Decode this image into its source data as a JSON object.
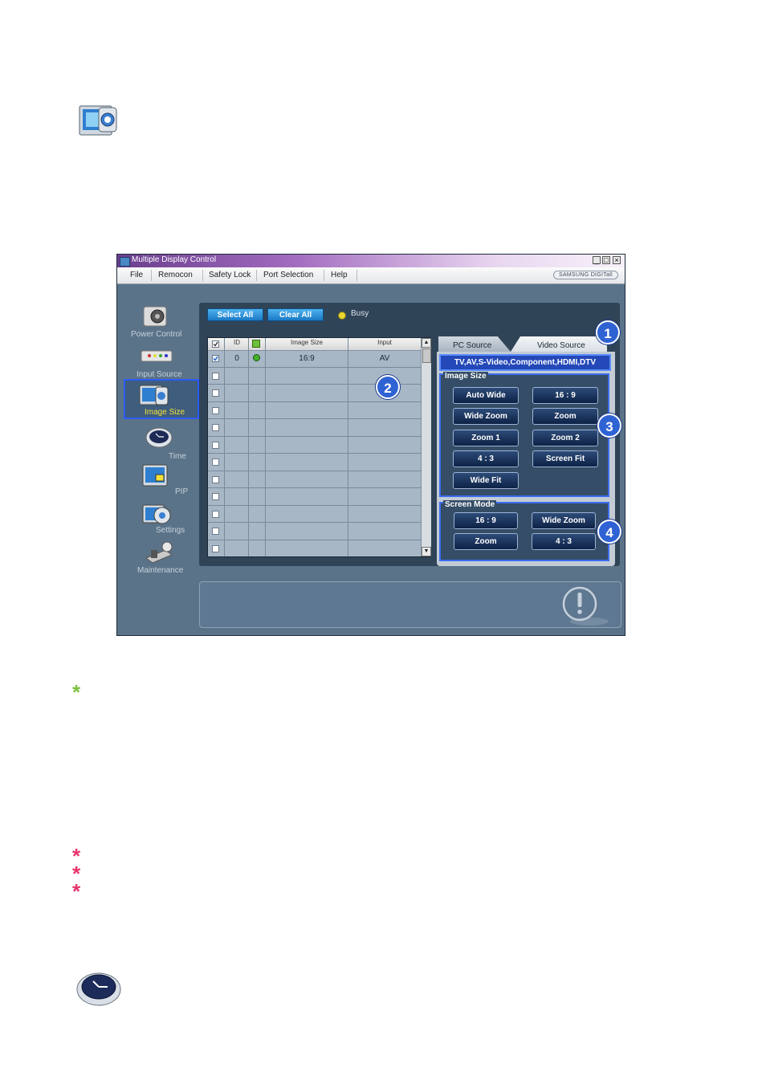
{
  "window": {
    "title": "Multiple Display Control",
    "brand": "SAMSUNG DIGITall",
    "controls": [
      "_",
      "□",
      "×"
    ]
  },
  "menu": [
    "File",
    "Remocon",
    "Safety Lock",
    "Port Selection",
    "Help"
  ],
  "sidebar": {
    "items": [
      {
        "label": "Power Control",
        "icon": "power-control-icon"
      },
      {
        "label": "Input Source",
        "icon": "input-source-icon"
      },
      {
        "label": "Image Size",
        "icon": "image-size-icon",
        "selected": true
      },
      {
        "label": "Time",
        "icon": "time-icon"
      },
      {
        "label": "PIP",
        "icon": "pip-icon"
      },
      {
        "label": "Settings",
        "icon": "settings-icon"
      },
      {
        "label": "Maintenance",
        "icon": "maintenance-icon"
      }
    ]
  },
  "toolbar": {
    "select_all": "Select All",
    "clear_all": "Clear All",
    "busy": "Busy"
  },
  "grid": {
    "columns": [
      "ID",
      "Image Size",
      "Input"
    ],
    "rows": [
      {
        "id": "0",
        "image_size": "16:9",
        "input": "AV"
      }
    ]
  },
  "tabs": {
    "pc_source": "PC Source",
    "video_source": "Video Source"
  },
  "source_bar": "TV,AV,S-Video,Component,HDMI,DTV",
  "image_size": {
    "title": "Image Size",
    "buttons": [
      "Auto Wide",
      "16 : 9",
      "Wide Zoom",
      "Zoom",
      "Zoom 1",
      "Zoom 2",
      "4 : 3",
      "Screen Fit",
      "Wide Fit"
    ]
  },
  "screen_mode": {
    "title": "Screen Mode",
    "buttons": [
      "16 : 9",
      "Wide Zoom",
      "Zoom",
      "4 : 3"
    ]
  },
  "callouts": [
    "1",
    "2",
    "3",
    "4"
  ],
  "colors": {
    "accent_blue": "#2f63d4",
    "busy_yellow": "#e9d632",
    "star_green": "#7dc142",
    "star_red": "#e8336b"
  }
}
